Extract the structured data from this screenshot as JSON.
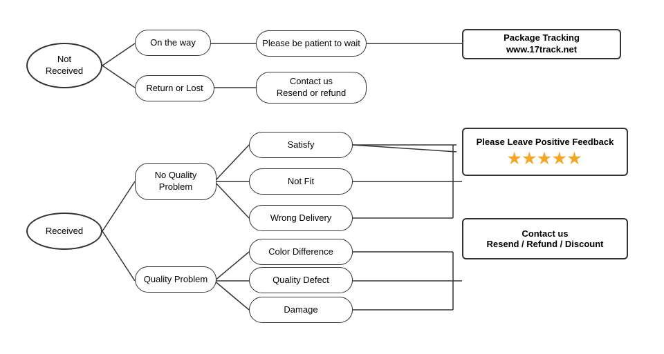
{
  "nodes": {
    "not_received": {
      "label": "Not\nReceived"
    },
    "on_the_way": {
      "label": "On the way"
    },
    "return_or_lost": {
      "label": "Return or Lost"
    },
    "patient": {
      "label": "Please be patient to wait"
    },
    "contact_resend_refund": {
      "label": "Contact us\nResend or refund"
    },
    "package_tracking": {
      "label": "Package Tracking\nwww.17track.net"
    },
    "received": {
      "label": "Received"
    },
    "no_quality_problem": {
      "label": "No Quality\nProblem"
    },
    "quality_problem": {
      "label": "Quality Problem"
    },
    "satisfy": {
      "label": "Satisfy"
    },
    "not_fit": {
      "label": "Not Fit"
    },
    "wrong_delivery": {
      "label": "Wrong Delivery"
    },
    "color_difference": {
      "label": "Color Difference"
    },
    "quality_defect": {
      "label": "Quality Defect"
    },
    "damage": {
      "label": "Damage"
    },
    "please_leave_feedback": {
      "label": "Please Leave Positive Feedback"
    },
    "contact_resend_refund_discount": {
      "label": "Contact us\nResend / Refund / Discount"
    }
  },
  "stars": "★★★★★"
}
